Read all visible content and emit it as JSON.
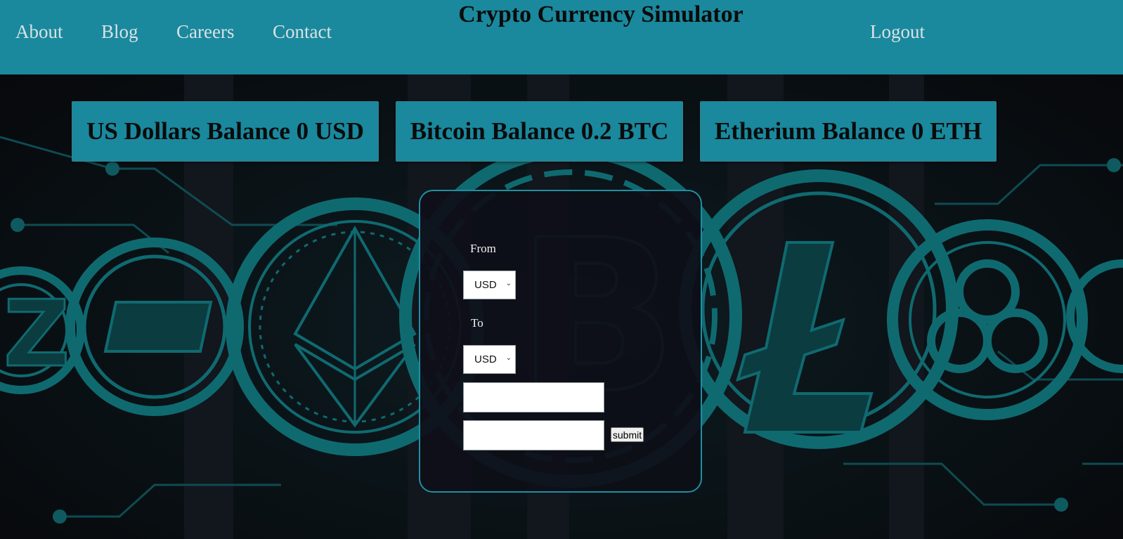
{
  "header": {
    "title": "Crypto Currency Simulator",
    "nav": {
      "about": "About",
      "blog": "Blog",
      "careers": "Careers",
      "contact": "Contact",
      "logout": "Logout"
    }
  },
  "balances": {
    "usd": "US Dollars Balance 0 USD",
    "btc": "Bitcoin Balance 0.2 BTC",
    "eth": "Etherium Balance 0 ETH"
  },
  "form": {
    "from_label": "From",
    "from_value": "USD",
    "to_label": "To",
    "to_value": "USD",
    "amount_value": "",
    "result_value": "",
    "submit_label": "submit"
  },
  "colors": {
    "accent": "#1a889d",
    "background": "#0b0c10",
    "coin_glow": "#0e5f63"
  },
  "icons": [
    "zcash-coin-icon",
    "dash-coin-icon",
    "ethereum-coin-icon",
    "bitcoin-coin-icon",
    "litecoin-coin-icon",
    "ripple-coin-icon"
  ]
}
